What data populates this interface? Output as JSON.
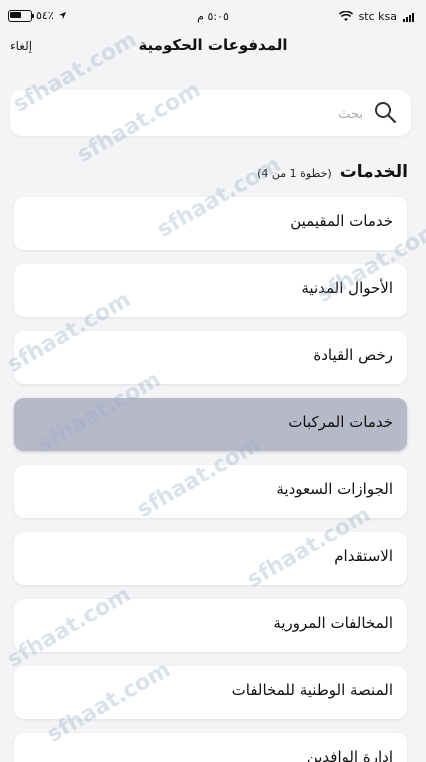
{
  "status_bar": {
    "carrier": "stc ksa",
    "time": "٥:٠٥ م",
    "battery": "٥٤٪",
    "battery_level": 0.54
  },
  "nav": {
    "title": "المدفوعات الحكومية",
    "cancel_label": "إلغاء"
  },
  "search": {
    "placeholder": "بحث",
    "value": ""
  },
  "section": {
    "title": "الخدمات",
    "step": "(خطوة 1 من 4)"
  },
  "services": [
    {
      "label": "خدمات المقيمين",
      "selected": false
    },
    {
      "label": "الأحوال المدنية",
      "selected": false
    },
    {
      "label": "رخص القيادة",
      "selected": false
    },
    {
      "label": "خدمات المركبات",
      "selected": true
    },
    {
      "label": "الجوازات السعودية",
      "selected": false
    },
    {
      "label": "الاستقدام",
      "selected": false
    },
    {
      "label": "المخالفات المرورية",
      "selected": false
    },
    {
      "label": "المنصة الوطنية للمخالفات",
      "selected": false
    },
    {
      "label": "إدارة الوافدين",
      "selected": false
    }
  ],
  "watermark": "sfhaat.com",
  "colors": {
    "background": "#f4f4f6",
    "card": "#ffffff",
    "selected_card": "#b7b9c9",
    "watermark": "#96afc8"
  }
}
